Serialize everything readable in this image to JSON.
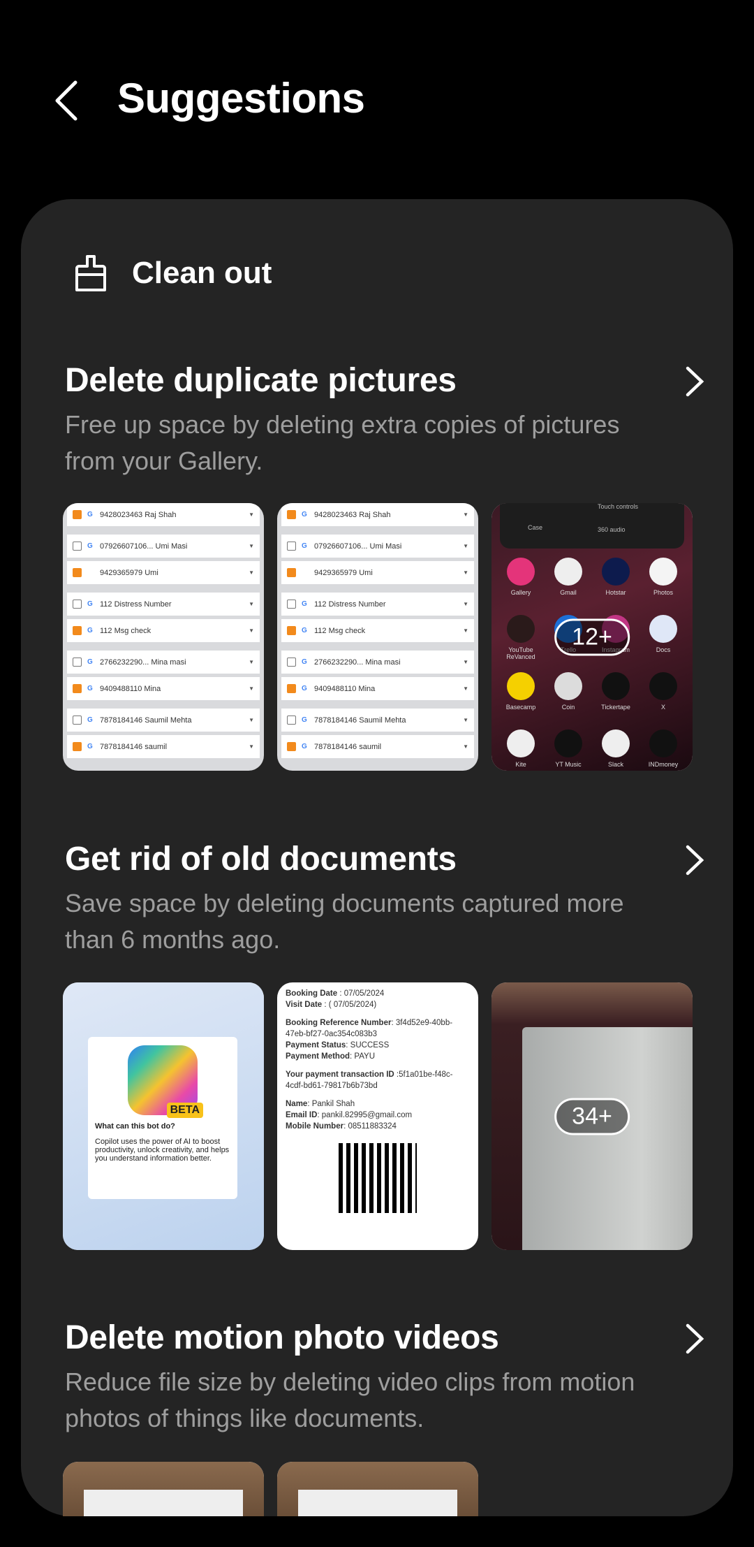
{
  "header": {
    "title": "Suggestions",
    "back_icon": "chevron-left-icon"
  },
  "category": {
    "title": "Clean out",
    "icon": "brush-icon"
  },
  "sections": [
    {
      "title": "Delete duplicate pictures",
      "description": "Free up space by deleting extra copies of pictures from your Gallery.",
      "more_count": "12+"
    },
    {
      "title": "Get rid of old documents",
      "description": "Save space by deleting documents captured more than 6 months ago.",
      "more_count": "34+"
    },
    {
      "title": "Delete motion photo videos",
      "description": "Reduce file size by deleting video clips from motion photos of things like documents."
    }
  ],
  "contacts": [
    {
      "name": "9428023463 Raj Shah",
      "checked": true,
      "g": true
    },
    {
      "name": "07926607106... Umi Masi",
      "checked": false,
      "g": true
    },
    {
      "name": "9429365979 Umi",
      "checked": true,
      "g": false
    },
    {
      "name": "112 Distress Number",
      "checked": false,
      "g": true
    },
    {
      "name": "112 Msg check",
      "checked": true,
      "g": true
    },
    {
      "name": "2766232290... Mina masi",
      "checked": false,
      "g": true
    },
    {
      "name": "9409488110 Mina",
      "checked": true,
      "g": true
    },
    {
      "name": "7878184146 Saumil Mehta",
      "checked": false,
      "g": true
    },
    {
      "name": "7878184146 saumil",
      "checked": true,
      "g": true
    }
  ],
  "home_panel": {
    "case": "Case",
    "touch": "Touch controls",
    "audio": "360 audio"
  },
  "apps": [
    {
      "name": "Gallery",
      "color": "#e4347a"
    },
    {
      "name": "Gmail",
      "color": "#eeeeee"
    },
    {
      "name": "Hotstar",
      "color": "#0d1b4d"
    },
    {
      "name": "Photos",
      "color": "#f4f4f4"
    },
    {
      "name": "YouTube ReVanced",
      "color": "#2a1a1a"
    },
    {
      "name": "Trello",
      "color": "#1d6fd6"
    },
    {
      "name": "Instagram",
      "color": "#c13584"
    },
    {
      "name": "Docs",
      "color": "#dfe7f7"
    },
    {
      "name": "Basecamp",
      "color": "#f5d000"
    },
    {
      "name": "Coin",
      "color": "#dcdcdc"
    },
    {
      "name": "Tickertape",
      "color": "#111"
    },
    {
      "name": "X",
      "color": "#111"
    },
    {
      "name": "Kite",
      "color": "#eeeeee"
    },
    {
      "name": "YT Music",
      "color": "#111"
    },
    {
      "name": "Slack",
      "color": "#eeeeee"
    },
    {
      "name": "INDmoney",
      "color": "#111"
    }
  ],
  "copilot": {
    "beta": "BETA",
    "question": "What can this bot do?",
    "answer": "Copilot uses the power of AI to boost productivity, unlock creativity, and helps you understand information better."
  },
  "booking": {
    "lines": [
      [
        "Booking Date",
        " : 07/05/2024"
      ],
      [
        "Visit Date",
        " : ( 07/05/2024)"
      ],
      null,
      [
        "Booking Reference Number",
        ": 3f4d52e9-40bb-47eb-bf27-0ac354c083b3"
      ],
      [
        "Payment Status",
        ": SUCCESS"
      ],
      [
        "Payment Method",
        ": PAYU"
      ],
      null,
      [
        "Your payment transaction ID",
        " :5f1a01be-f48c-4cdf-bd61-79817b6b73bd"
      ],
      null,
      [
        "Name",
        ": Pankil Shah"
      ],
      [
        "Email ID",
        ": pankil.82995@gmail.com"
      ],
      [
        "Mobile Number",
        ": 08511883324"
      ]
    ]
  },
  "colors": {
    "card": "#242424",
    "description": "#9e9e9e",
    "checkbox": "#f28a1c"
  }
}
